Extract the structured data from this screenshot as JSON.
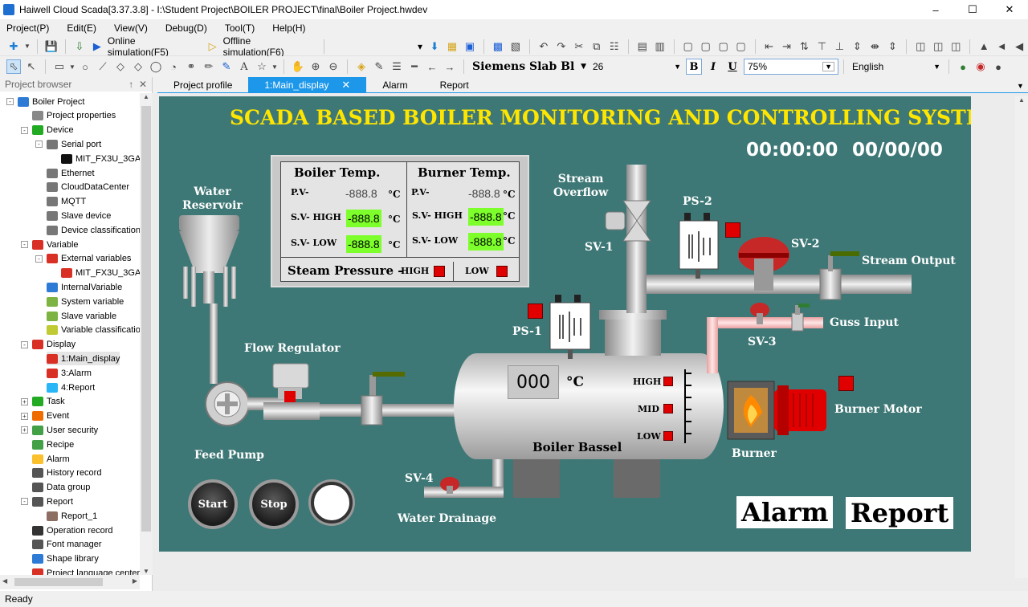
{
  "window": {
    "title": "Haiwell Cloud Scada[3.37.3.8] - I:\\Student Project\\BOILER PROJECT\\final\\Boiler Project.hwdev"
  },
  "menu": [
    "Project(P)",
    "Edit(E)",
    "View(V)",
    "Debug(D)",
    "Tool(T)",
    "Help(H)"
  ],
  "toolbar": {
    "online_sim": "Online simulation(F5)",
    "offline_sim": "Offline simulation(F6)",
    "font_name": "Siemens Slab Bl",
    "font_size": "26",
    "zoom": "75%",
    "language": "English",
    "bold": "B",
    "italic": "I",
    "underline": "U"
  },
  "sidebar": {
    "title": "Project browser",
    "items": [
      {
        "label": "Boiler Project",
        "indent": 0,
        "color": "#2e7bd6",
        "exp": "-"
      },
      {
        "label": "Project properties",
        "indent": 1,
        "color": "#888888",
        "exp": ""
      },
      {
        "label": "Device",
        "indent": 1,
        "color": "#22aa22",
        "exp": "-"
      },
      {
        "label": "Serial port",
        "indent": 2,
        "color": "#777777",
        "exp": "-"
      },
      {
        "label": "MIT_FX3U_3GA",
        "indent": 3,
        "color": "#111111",
        "exp": ""
      },
      {
        "label": "Ethernet",
        "indent": 2,
        "color": "#777777",
        "exp": ""
      },
      {
        "label": "CloudDataCenter",
        "indent": 2,
        "color": "#777777",
        "exp": ""
      },
      {
        "label": "MQTT",
        "indent": 2,
        "color": "#777777",
        "exp": ""
      },
      {
        "label": "Slave device",
        "indent": 2,
        "color": "#777777",
        "exp": ""
      },
      {
        "label": "Device classification",
        "indent": 2,
        "color": "#777777",
        "exp": ""
      },
      {
        "label": "Variable",
        "indent": 1,
        "color": "#d93025",
        "exp": "-"
      },
      {
        "label": "External variables",
        "indent": 2,
        "color": "#d93025",
        "exp": "-"
      },
      {
        "label": "MIT_FX3U_3GA",
        "indent": 3,
        "color": "#d93025",
        "exp": ""
      },
      {
        "label": "InternalVariable",
        "indent": 2,
        "color": "#2e7bd6",
        "exp": ""
      },
      {
        "label": "System variable",
        "indent": 2,
        "color": "#7cb342",
        "exp": ""
      },
      {
        "label": "Slave variable",
        "indent": 2,
        "color": "#7cb342",
        "exp": ""
      },
      {
        "label": "Variable classification",
        "indent": 2,
        "color": "#c0ca33",
        "exp": ""
      },
      {
        "label": "Display",
        "indent": 1,
        "color": "#d93025",
        "exp": "-"
      },
      {
        "label": "1:Main_display",
        "indent": 2,
        "color": "#d93025",
        "exp": ""
      },
      {
        "label": "3:Alarm",
        "indent": 2,
        "color": "#d93025",
        "exp": ""
      },
      {
        "label": "4:Report",
        "indent": 2,
        "color": "#29b6f6",
        "exp": ""
      },
      {
        "label": "Task",
        "indent": 1,
        "color": "#22aa22",
        "exp": "+"
      },
      {
        "label": "Event",
        "indent": 1,
        "color": "#ef6c00",
        "exp": "+"
      },
      {
        "label": "User security",
        "indent": 1,
        "color": "#43a047",
        "exp": "+"
      },
      {
        "label": "Recipe",
        "indent": 1,
        "color": "#43a047",
        "exp": ""
      },
      {
        "label": "Alarm",
        "indent": 1,
        "color": "#fbc02d",
        "exp": ""
      },
      {
        "label": "History record",
        "indent": 1,
        "color": "#555555",
        "exp": ""
      },
      {
        "label": "Data group",
        "indent": 1,
        "color": "#555555",
        "exp": ""
      },
      {
        "label": "Report",
        "indent": 1,
        "color": "#555555",
        "exp": "-"
      },
      {
        "label": "Report_1",
        "indent": 2,
        "color": "#8d6e63",
        "exp": ""
      },
      {
        "label": "Operation record",
        "indent": 1,
        "color": "#333333",
        "exp": ""
      },
      {
        "label": "Font manager",
        "indent": 1,
        "color": "#555555",
        "exp": ""
      },
      {
        "label": "Shape library",
        "indent": 1,
        "color": "#2e7bd6",
        "exp": ""
      },
      {
        "label": "Project language center",
        "indent": 1,
        "color": "#d93025",
        "exp": ""
      }
    ]
  },
  "tabs": [
    {
      "label": "Project profile",
      "active": false
    },
    {
      "label": "1:Main_display",
      "active": true
    },
    {
      "label": "Alarm",
      "active": false
    },
    {
      "label": "Report",
      "active": false
    }
  ],
  "screen": {
    "title": "SCADA BASED BOILER MONITORING AND CONTROLLING SYSTEM.",
    "time": "00:00:00",
    "date": "00/00/00",
    "boiler_temp_title": "Boiler Temp.",
    "burner_temp_title": "Burner Temp.",
    "pv_label": "P.V-",
    "sv_high_label": "S.V- HIGH",
    "sv_low_label": "S.V- LOW",
    "boiler_pv": "-888.8",
    "boiler_sv_high": "-888.8",
    "boiler_sv_low": "-888.8",
    "burner_pv": "-888.8",
    "burner_sv_high": "-888.8",
    "burner_sv_low": "-888.8",
    "unit": "°C",
    "steam_pressure_label": "Steam Pressure -",
    "high_label": "HIGH",
    "low_label": "LOW",
    "water_reservoir": "Water\nReservoir",
    "flow_regulator": "Flow Regulator",
    "feed_pump": "Feed Pump",
    "stream_overflow": "Stream\nOverflow",
    "sv1": "SV-1",
    "sv2": "SV-2",
    "sv3": "SV-3",
    "sv4": "SV-4",
    "ps1": "PS-1",
    "ps2": "PS-2",
    "stream_output": "Stream Output",
    "guss_input": "Guss Input",
    "boiler_bassel": "Boiler Bassel",
    "boiler_temp_value": "000",
    "level_high": "HIGH",
    "level_mid": "MID",
    "level_low": "LOW",
    "burner": "Burner",
    "burner_motor": "Burner Motor",
    "water_drainage": "Water Drainage",
    "start": "Start",
    "stop": "Stop",
    "alarm_btn": "Alarm",
    "report_btn": "Report"
  },
  "colors": {
    "canvas_bg": "#3e7876",
    "title_yellow": "#ffe600",
    "indicator_green": "#7cff2a",
    "alarm_red": "#e00000",
    "tab_active": "#1c97ea"
  },
  "status": "Ready"
}
